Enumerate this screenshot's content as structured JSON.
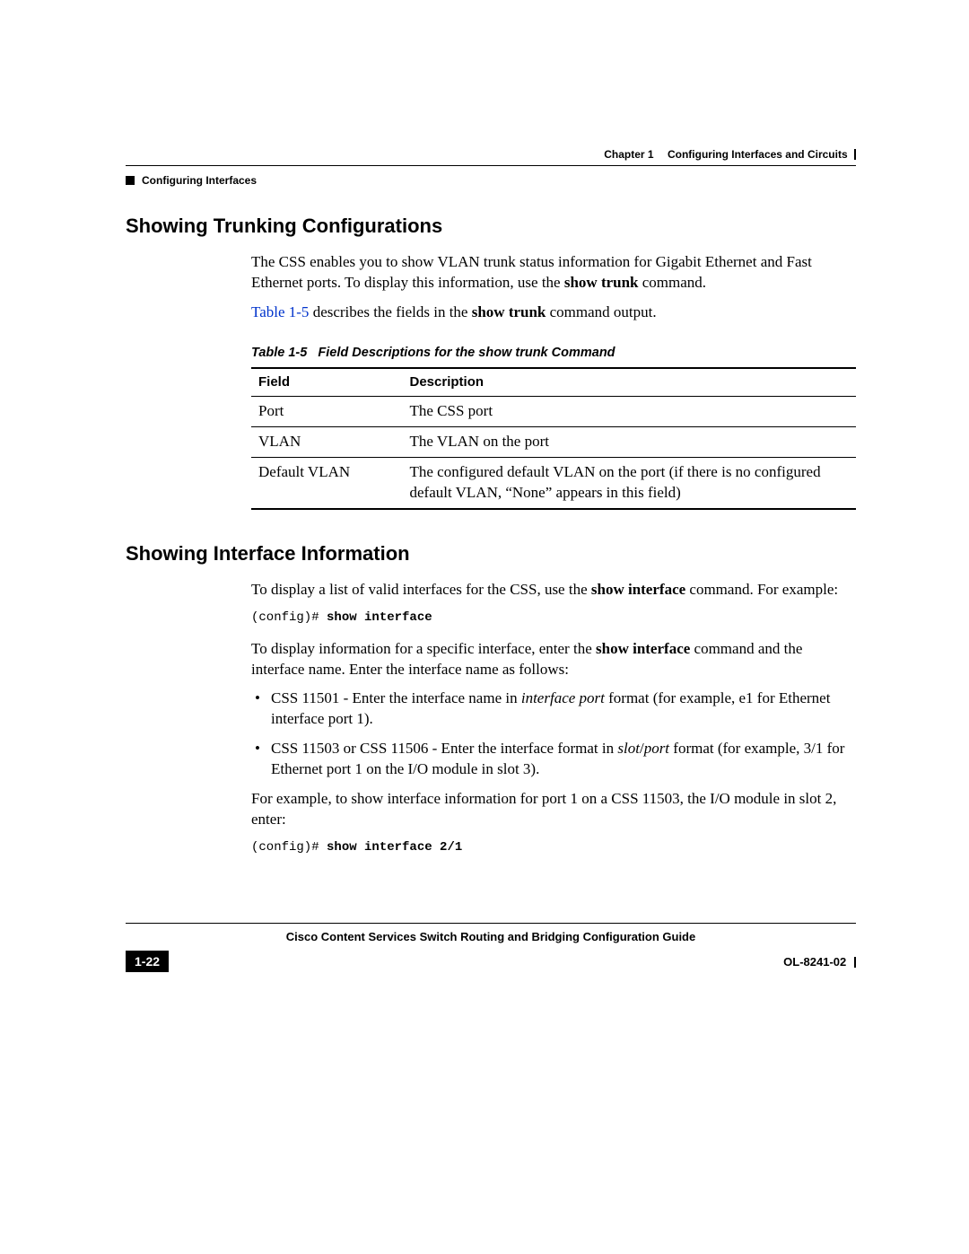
{
  "header": {
    "chapter_label": "Chapter 1",
    "chapter_title": "Configuring Interfaces and Circuits",
    "section": "Configuring Interfaces"
  },
  "section1": {
    "title": "Showing Trunking Configurations",
    "p1_pre": "The CSS enables you to show VLAN trunk status information for Gigabit Ethernet and Fast Ethernet ports. To display this information, use the ",
    "p1_cmd": "show trunk",
    "p1_post": " command.",
    "p2_link": "Table 1-5",
    "p2_mid": " describes the fields in the ",
    "p2_cmd": "show trunk",
    "p2_post": " command output.",
    "table_caption_num": "Table 1-5",
    "table_caption_title": "Field Descriptions for the show trunk Command",
    "th1": "Field",
    "th2": "Description",
    "rows": [
      {
        "f": "Port",
        "d": "The CSS port"
      },
      {
        "f": "VLAN",
        "d": "The VLAN on the port"
      },
      {
        "f": "Default VLAN",
        "d": "The configured default VLAN on the port (if there is no configured default VLAN, “None” appears in this field)"
      }
    ]
  },
  "section2": {
    "title": "Showing Interface Information",
    "p1_pre": "To display a list of valid interfaces for the CSS, use the ",
    "p1_cmd": "show interface",
    "p1_post": " command. For example:",
    "code1_prompt": "(config)# ",
    "code1_cmd": "show interface",
    "p2_pre": "To display information for a specific interface, enter the ",
    "p2_cmd": "show interface",
    "p2_post": " command and the interface name. Enter the interface name as follows:",
    "li1_pre": "CSS 11501 - Enter the interface name in ",
    "li1_ital": "interface port",
    "li1_post": " format (for example, e1 for Ethernet interface port 1).",
    "li2_pre": "CSS 11503 or CSS 11506 - Enter the interface format in ",
    "li2_ital1": "slot",
    "li2_slash": "/",
    "li2_ital2": "port",
    "li2_post": " format (for example, 3/1 for Ethernet port 1 on the I/O module in slot 3).",
    "p3": "For example, to show interface information for port 1 on a CSS 11503, the I/O module in slot 2, enter:",
    "code2_prompt": "(config)# ",
    "code2_cmd": "show interface 2/1"
  },
  "footer": {
    "book_title": "Cisco Content Services Switch Routing and Bridging Configuration Guide",
    "page_num": "1-22",
    "doc_num": "OL-8241-02"
  }
}
